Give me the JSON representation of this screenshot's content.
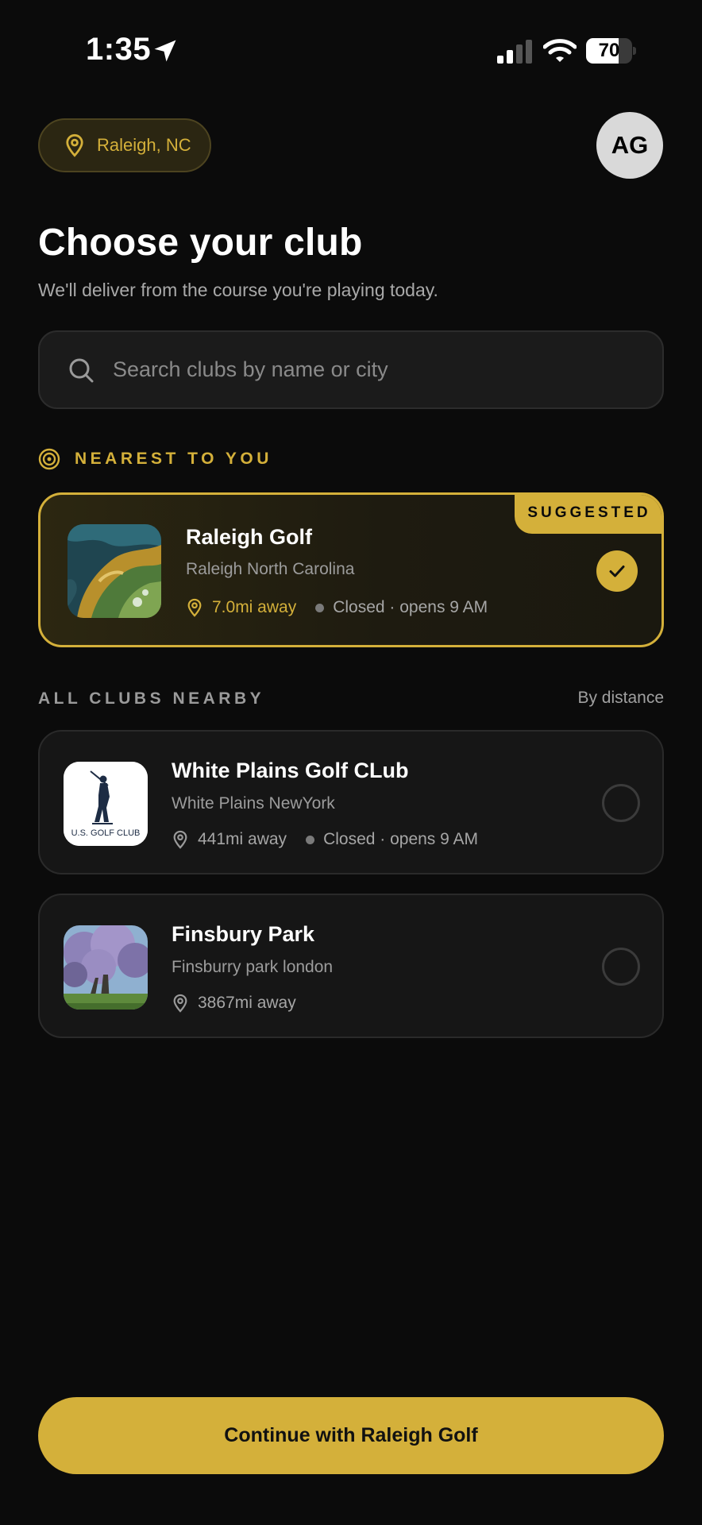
{
  "status_bar": {
    "time": "1:35",
    "battery": "70",
    "battery_level": 0.7
  },
  "header": {
    "location_label": "Raleigh, NC",
    "avatar_initials": "AG"
  },
  "title": "Choose your club",
  "subtitle": "We'll deliver from the course you're playing today.",
  "search": {
    "placeholder": "Search clubs by name or city",
    "value": ""
  },
  "nearest": {
    "label": "NEAREST TO YOU",
    "badge": "SUGGESTED",
    "club": {
      "name": "Raleigh Golf",
      "location": "Raleigh North Carolina",
      "distance": "7.0mi away",
      "hours": "Closed · opens 9 AM",
      "selected": true
    }
  },
  "all_clubs": {
    "label": "ALL CLUBS NEARBY",
    "sort_label": "By distance",
    "clubs": [
      {
        "name": "White Plains Golf CLub",
        "location": "White Plains NewYork",
        "distance": "441mi away",
        "hours": "Closed · opens 9 AM",
        "thumb_text": "U.S. GOLF CLUB",
        "selected": false
      },
      {
        "name": "Finsbury Park",
        "location": "Finsburry park london",
        "distance": "3867mi away",
        "selected": false
      }
    ]
  },
  "continue_button": "Continue with Raleigh Golf",
  "colors": {
    "accent": "#d4b03a",
    "background": "#0b0b0b",
    "card": "#161616"
  }
}
